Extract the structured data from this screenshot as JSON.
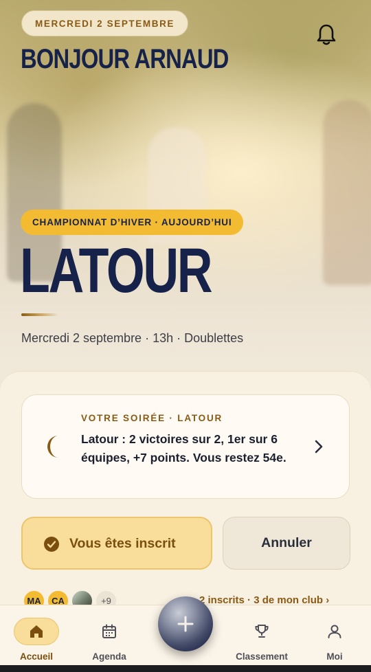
{
  "header": {
    "date_label": "MERCREDI 2 SEPTEMBRE",
    "greeting": "BONJOUR ARNAUD",
    "bell_icon": "bell-icon"
  },
  "event": {
    "badge": "CHAMPIONNAT D’HIVER · AUJOURD’HUI",
    "venue": "LATOUR",
    "details": "Mercredi 2 septembre · 13h · Doublettes"
  },
  "soiree_card": {
    "label": "VOTRE SOIRÉE · LATOUR",
    "text": "Latour : 2 victoires sur 2, 1er sur 6 équipes, +7 points. Vous restez 54e.",
    "icon": "moon-icon"
  },
  "actions": {
    "registered_label": "Vous êtes inscrit",
    "cancel_label": "Annuler"
  },
  "attendees": {
    "avatars": [
      "MA",
      "CA"
    ],
    "more": "+9",
    "summary": "2 inscrits · 3 de mon club ›"
  },
  "nav": {
    "items": [
      {
        "label": "Accueil",
        "icon": "home-icon",
        "active": true
      },
      {
        "label": "Agenda",
        "icon": "calendar-icon",
        "active": false
      },
      {
        "label": "Classement",
        "icon": "trophy-icon",
        "active": false
      },
      {
        "label": "Moi",
        "icon": "user-icon",
        "active": false
      }
    ],
    "fab_icon": "plus-icon"
  },
  "colors": {
    "navy": "#16224a",
    "gold": "#f3bb32",
    "bronze": "#8a5a14",
    "cream": "#f8f0e1"
  }
}
